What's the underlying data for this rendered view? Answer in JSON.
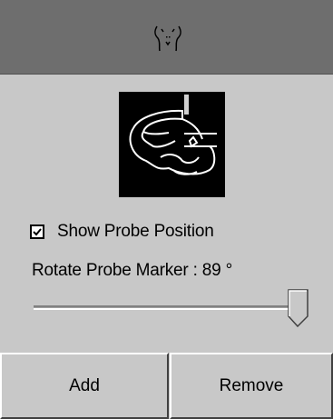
{
  "header": {
    "icon": "torso-outline-icon"
  },
  "preview": {
    "icon": "probe-position-preview"
  },
  "show_probe": {
    "label": "Show Probe Position",
    "checked": true
  },
  "rotate": {
    "label": "Rotate Probe Marker : 89 °",
    "value": 89
  },
  "buttons": {
    "add_label": "Add",
    "remove_label": "Remove"
  }
}
